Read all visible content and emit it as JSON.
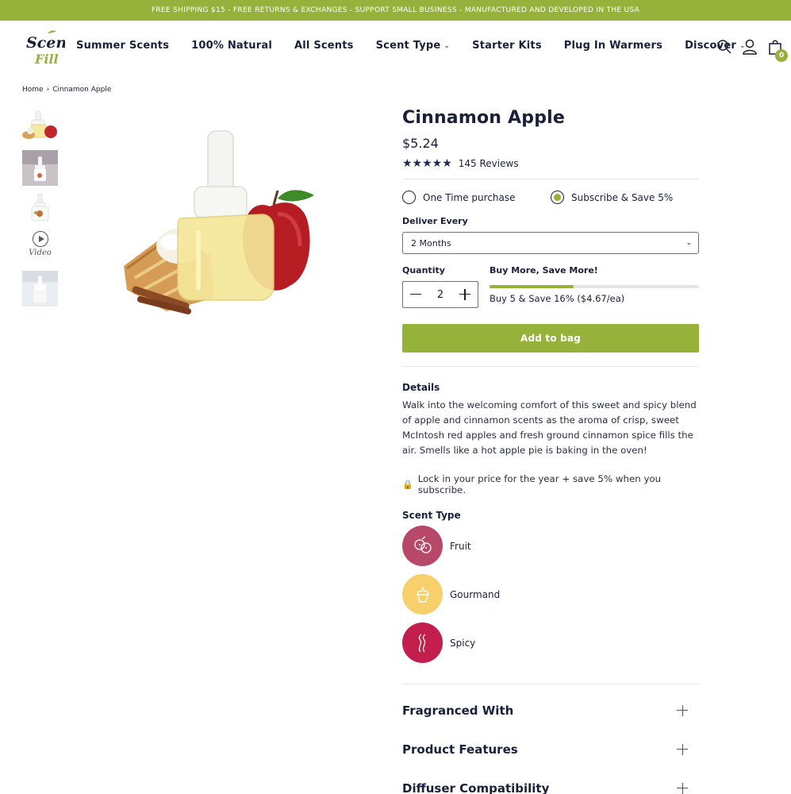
{
  "promo": {
    "text": "FREE SHIPPING $15 - FREE RETURNS & EXCHANGES - SUPPORT SMALL BUSINESS - MANUFACTURED AND DEVELOPED IN THE USA"
  },
  "brand": {
    "line1": "Scent",
    "line2": "Fill",
    "primary_color": "#1a1f3a",
    "accent_color": "#96b23a"
  },
  "nav": {
    "items": [
      {
        "label": "Summer Scents",
        "dropdown": false
      },
      {
        "label": "100% Natural",
        "dropdown": false
      },
      {
        "label": "All Scents",
        "dropdown": false
      },
      {
        "label": "Scent Type",
        "dropdown": true
      },
      {
        "label": "Starter Kits",
        "dropdown": false
      },
      {
        "label": "Plug In Warmers",
        "dropdown": false
      },
      {
        "label": "Discover",
        "dropdown": true
      }
    ],
    "icons": [
      "search-icon",
      "user-icon",
      "bag-icon"
    ],
    "cart_count": "0"
  },
  "breadcrumb": {
    "home": "Home",
    "separator": "›",
    "current": "Cinnamon Apple"
  },
  "gallery": {
    "video_label": "Video"
  },
  "product": {
    "title": "Cinnamon Apple",
    "price": "$5.24",
    "rating_stars": 4.5,
    "reviews": "145 Reviews",
    "purchase_options": [
      {
        "label": "One Time purchase",
        "selected": false
      },
      {
        "label": "Subscribe & Save 5%",
        "selected": true
      }
    ],
    "deliver_label": "Deliver Every",
    "deliver_value": "2 Months",
    "quantity_label": "Quantity",
    "quantity_value": "2",
    "bulk_label": "Buy More, Save More!",
    "bulk_progress": 0.4,
    "bulk_text": "Buy 5 & Save 16% ($4.67/ea)",
    "add_button": "Add to bag",
    "details_title": "Details",
    "details_body": "Walk into the welcoming comfort of this sweet and spicy blend of apple and cinnamon scents as the aroma of crisp, sweet McIntosh red apples and fresh ground cinnamon spice fills the air. Smells like a hot apple pie is baking in the oven!",
    "lock_text": "Lock in your price for the year + save 5% when you subscribe.",
    "scent_type_title": "Scent Type",
    "scent_types": [
      {
        "label": "Fruit",
        "icon": "berries-icon",
        "color": "#b8486a"
      },
      {
        "label": "Gourmand",
        "icon": "cupcake-icon",
        "color": "#f7cf6b"
      },
      {
        "label": "Spicy",
        "icon": "smoke-icon",
        "color": "#c21f4c"
      }
    ],
    "accordion": [
      {
        "label": "Fragranced With"
      },
      {
        "label": "Product Features"
      },
      {
        "label": "Diffuser Compatibility"
      }
    ]
  }
}
